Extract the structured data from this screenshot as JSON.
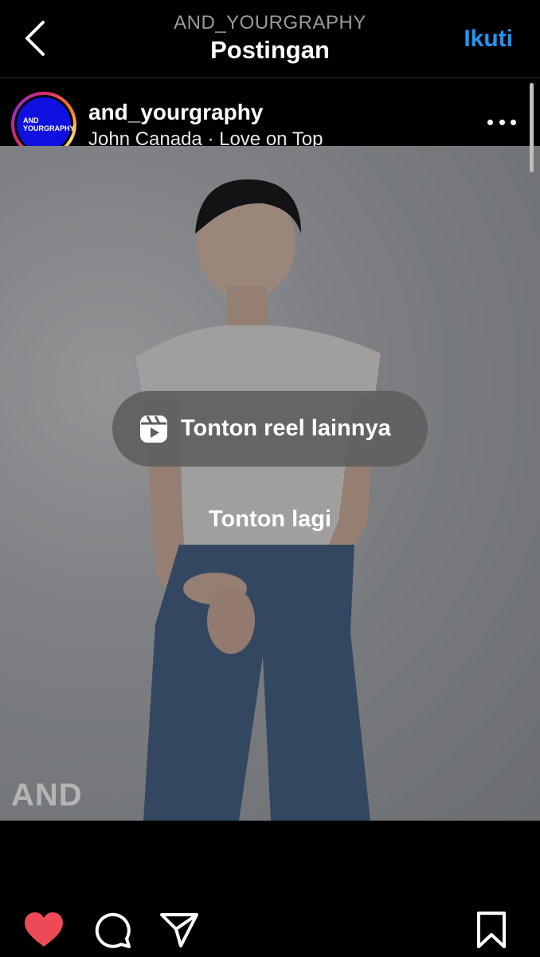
{
  "header": {
    "account_handle": "AND_YOURGRAPHY",
    "title": "Postingan",
    "follow_label": "Ikuti"
  },
  "post": {
    "avatar_text_line1": "AND",
    "avatar_text_line2": "YOURGRAPHY.",
    "username": "and_yourgraphy",
    "audio": "John Canada · Love on Top"
  },
  "media": {
    "watermark": "AND",
    "reels_button_label": "Tonton reel lainnya",
    "replay_label": "Tonton lagi"
  },
  "actions": {
    "like_icon": "heart-filled-icon",
    "comment_icon": "comment-icon",
    "share_icon": "send-icon",
    "save_icon": "bookmark-icon"
  },
  "colors": {
    "accent": "#2196f3",
    "like": "#ed4956",
    "avatar_bg": "#1010e0"
  }
}
